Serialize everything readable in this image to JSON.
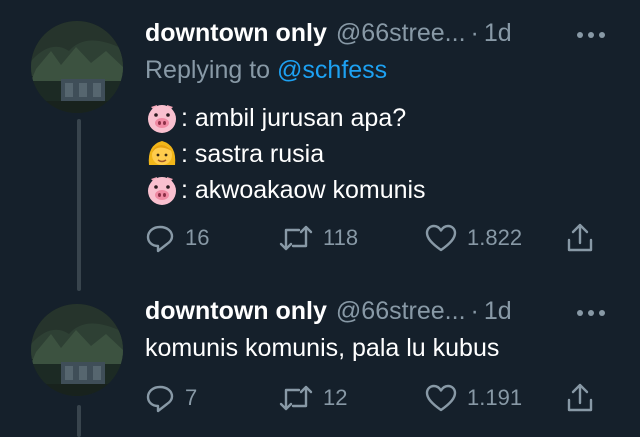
{
  "tweets": [
    {
      "name": "downtown only",
      "handle": "@66stree...",
      "dot": "·",
      "time": "1d",
      "more_icon": "ellipsis-icon",
      "replying_label": "Replying to",
      "replying_mention": "@schfess",
      "lines": [
        {
          "emoji": "pig-face-emoji",
          "text": ": ambil jurusan apa?"
        },
        {
          "emoji": "woman-blond-emoji",
          "text": ": sastra rusia"
        },
        {
          "emoji": "pig-face-emoji",
          "text": ": akwoakaow komunis"
        }
      ],
      "replies": "16",
      "retweets": "118",
      "likes": "1.822"
    },
    {
      "name": "downtown only",
      "handle": "@66stree...",
      "dot": "·",
      "time": "1d",
      "more_icon": "ellipsis-icon",
      "text": "komunis komunis, pala lu kubus",
      "replies": "7",
      "retweets": "12",
      "likes": "1.191"
    }
  ],
  "colors": {
    "background": "#15202b",
    "secondary_text": "#8899a6",
    "mention": "#1da1f2",
    "thread_line": "#38444d"
  }
}
